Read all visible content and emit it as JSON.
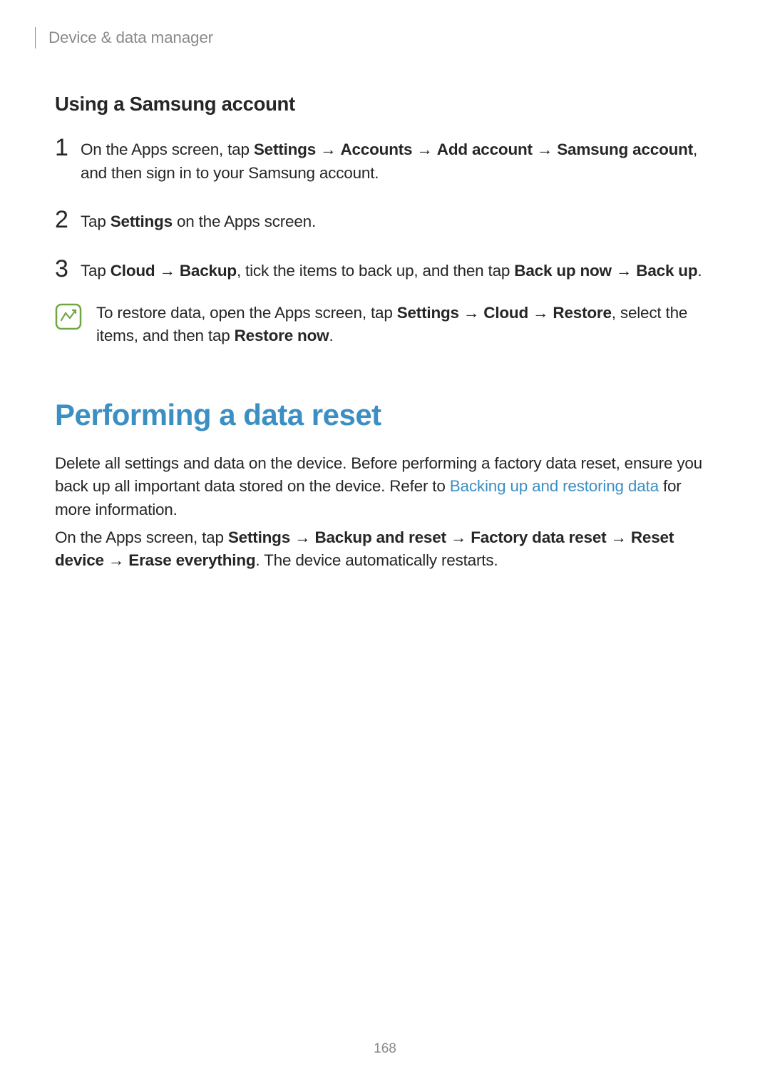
{
  "header": {
    "breadcrumb": "Device & data manager"
  },
  "section1": {
    "heading": "Using a Samsung account",
    "steps": [
      {
        "num": "1",
        "pre": "On the Apps screen, tap ",
        "b1": "Settings",
        "arr1": " → ",
        "b2": "Accounts",
        "arr2": " → ",
        "b3": "Add account",
        "arr3": " → ",
        "b4": "Samsung account",
        "post": ", and then sign in to your Samsung account."
      },
      {
        "num": "2",
        "pre": "Tap ",
        "b1": "Settings",
        "post": " on the Apps screen."
      },
      {
        "num": "3",
        "pre": "Tap ",
        "b1": "Cloud",
        "arr1": " → ",
        "b2": "Backup",
        "mid": ", tick the items to back up, and then tap ",
        "b3": "Back up now",
        "arr2": " → ",
        "b4": "Back up",
        "post": "."
      }
    ],
    "note": {
      "pre": "To restore data, open the Apps screen, tap ",
      "b1": "Settings",
      "arr1": " → ",
      "b2": "Cloud",
      "arr2": " → ",
      "b3": "Restore",
      "mid": ", select the items, and then tap ",
      "b4": "Restore now",
      "post": "."
    }
  },
  "section2": {
    "heading": "Performing a data reset",
    "para1": {
      "pre": "Delete all settings and data on the device. Before performing a factory data reset, ensure you back up all important data stored on the device. Refer to ",
      "link": "Backing up and restoring data",
      "post": " for more information."
    },
    "para2": {
      "pre": "On the Apps screen, tap ",
      "b1": "Settings",
      "arr1": " → ",
      "b2": "Backup and reset",
      "arr2": " → ",
      "b3": "Factory data reset",
      "arr3": " → ",
      "b4": "Reset device",
      "arr4": " → ",
      "b5": "Erase everything",
      "post": ". The device automatically restarts."
    }
  },
  "pageNumber": "168"
}
